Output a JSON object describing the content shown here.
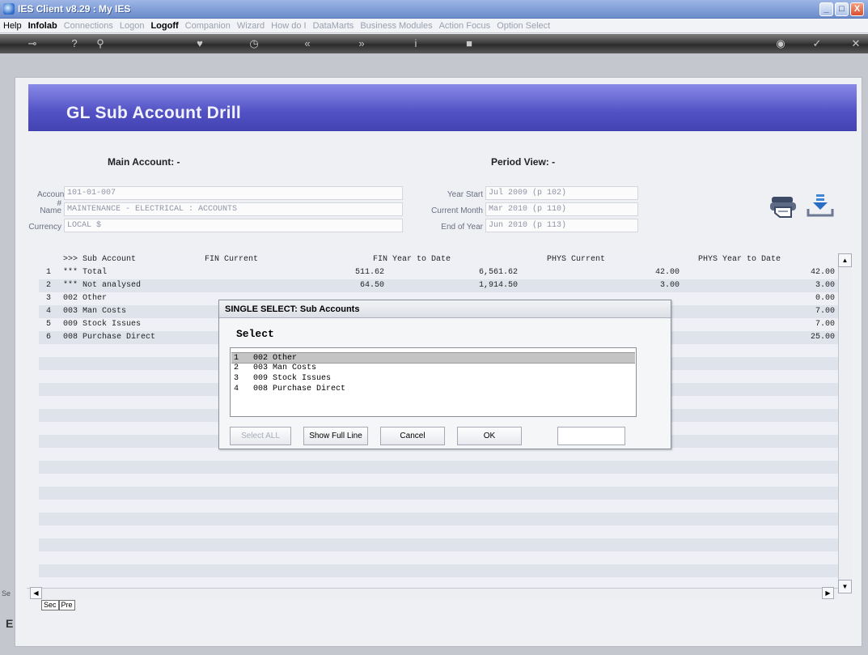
{
  "window": {
    "title": "IES Client v8.29 : My IES",
    "buttons": [
      "_",
      "□",
      "X"
    ]
  },
  "menu": [
    {
      "label": "Help",
      "state": "on"
    },
    {
      "label": "Infolab",
      "state": "bold"
    },
    {
      "label": "Connections",
      "state": "off"
    },
    {
      "label": "Logon",
      "state": "off"
    },
    {
      "label": "Logoff",
      "state": "bold"
    },
    {
      "label": "Companion",
      "state": "off"
    },
    {
      "label": "Wizard",
      "state": "off"
    },
    {
      "label": "How do I",
      "state": "off"
    },
    {
      "label": "DataMarts",
      "state": "off"
    },
    {
      "label": "Business Modules",
      "state": "off"
    },
    {
      "label": "Action Focus",
      "state": "off"
    },
    {
      "label": "Option Select",
      "state": "off"
    }
  ],
  "toolbar": {
    "icons": [
      "key-icon",
      "help-icon",
      "search-icon",
      "heart-icon",
      "clock-icon",
      "back-icon",
      "forward-icon",
      "info-icon",
      "stop-icon",
      "camera-icon",
      "check-icon",
      "close-icon"
    ]
  },
  "page": {
    "banner_title": "GL Sub Account Drill",
    "main_account_label": "Main Account: -",
    "period_view_label": "Period View: -",
    "account_label": "Account #",
    "account_value": "101-01-007",
    "name_label": "Name",
    "name_value": "MAINTENANCE - ELECTRICAL : ACCOUNTS",
    "currency_label": "Currency",
    "currency_value": "LOCAL $",
    "year_start_label": "Year Start",
    "year_start_value": "Jul 2009 (p 102)",
    "current_month_label": "Current Month",
    "current_month_value": "Mar 2010 (p 110)",
    "end_year_label": "End of Year",
    "end_year_value": "Jun 2010 (p 113)",
    "side_left": "Se",
    "side_left2": "E"
  },
  "grid": {
    "headers": {
      "sub_account": ">>> Sub Account",
      "fin_current": "FIN Current",
      "fin_ytd": "FIN Year to Date",
      "phys_current": "PHYS Current",
      "phys_ytd": "PHYS Year to Date"
    },
    "rows": [
      {
        "n": "1",
        "name": "*** Total",
        "fin_current": "511.62",
        "fin_ytd": "6,561.62",
        "phys_current": "42.00",
        "phys_ytd": "42.00"
      },
      {
        "n": "2",
        "name": "*** Not analysed",
        "fin_current": "64.50",
        "fin_ytd": "1,914.50",
        "phys_current": "3.00",
        "phys_ytd": "3.00"
      },
      {
        "n": "3",
        "name": "002 Other",
        "fin_current": "",
        "fin_ytd": "",
        "phys_current": "",
        "phys_ytd": "0.00"
      },
      {
        "n": "4",
        "name": "003 Man Costs",
        "fin_current": "",
        "fin_ytd": "",
        "phys_current": "",
        "phys_ytd": "7.00"
      },
      {
        "n": "5",
        "name": "009 Stock Issues",
        "fin_current": "",
        "fin_ytd": "",
        "phys_current": "",
        "phys_ytd": "7.00"
      },
      {
        "n": "6",
        "name": "008 Purchase Direct",
        "fin_current": "",
        "fin_ytd": "",
        "phys_current": "",
        "phys_ytd": "25.00"
      }
    ],
    "tabs": [
      "Sec",
      "Pre"
    ]
  },
  "dialog": {
    "title": "SINGLE SELECT: Sub Accounts",
    "heading": "Select",
    "items": [
      {
        "n": "1",
        "label": "002 Other"
      },
      {
        "n": "2",
        "label": "003 Man Costs"
      },
      {
        "n": "3",
        "label": "009 Stock Issues"
      },
      {
        "n": "4",
        "label": "008 Purchase Direct"
      }
    ],
    "selected_index": 0,
    "buttons": {
      "select_all": "Select ALL",
      "show_full_line": "Show Full Line",
      "cancel": "Cancel",
      "ok": "OK"
    },
    "filter_value": ""
  }
}
